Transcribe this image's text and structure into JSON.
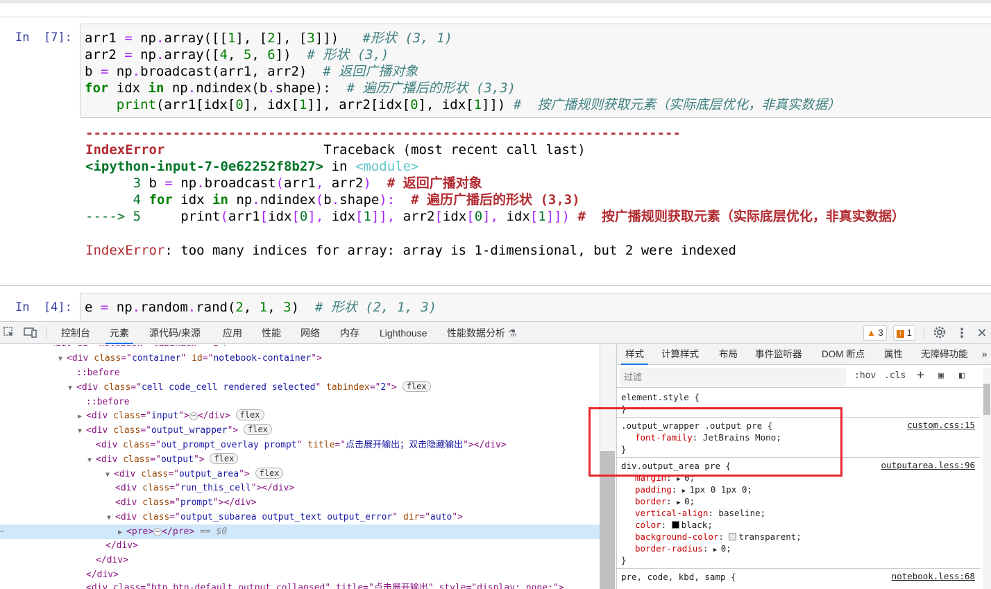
{
  "notebook": {
    "cell7": {
      "prompt": "In  [7]:",
      "lines": [
        "arr1 = np.array([[1], [2], [3]])   #形状 (3, 1)",
        "arr2 = np.array([4, 5, 6])  # 形状 (3,)",
        "b = np.broadcast(arr1, arr2)  # 返回广播对象",
        "for idx in np.ndindex(b.shape):  # 遍历广播后的形状 (3,3)",
        "    print(arr1[idx[0], idx[1]], arr2[idx[0], idx[1]]) #  按广播规则获取元素（实际底层优化，非真实数据）"
      ]
    },
    "output7": {
      "dashes": "---------------------------------------------------------------------------",
      "error_name": "IndexError",
      "traceback_label": "Traceback (most recent call last)",
      "input_ref": "<ipython-input-7-0e62252f8b27>",
      "in_word": " in ",
      "module": "<module>",
      "tb_lines": [
        "      3 b = np.broadcast(arr1, arr2)  # 返回广播对象",
        "      4 for idx in np.ndindex(b.shape):  # 遍历广播后的形状 (3,3)",
        "----> 5     print(arr1[idx[0], idx[1]], arr2[idx[0], idx[1]]) #  按广播规则获取元素（实际底层优化，非真实数据）"
      ],
      "error_message": ": too many indices for array: array is 1-dimensional, but 2 were indexed"
    },
    "cell4": {
      "prompt": "In  [4]:",
      "line": "e = np.random.rand(2, 1, 3)  # 形状 (2, 1, 3)"
    }
  },
  "devtools": {
    "tabs": [
      "控制台",
      "元素",
      "源代码/来源",
      "应用",
      "性能",
      "网络",
      "内存",
      "Lighthouse",
      "性能数据分析"
    ],
    "active_tab": "元素",
    "warning_count": "3",
    "issue_count": "1",
    "elements": [
      {
        "text": "<div id=\"notebook\" tabindex=\"-1\">"
      },
      {
        "tag": "div",
        "attrs": [
          [
            "class",
            "container"
          ],
          [
            "id",
            "notebook-container"
          ]
        ]
      },
      {
        "pseudo": "::before"
      },
      {
        "tag": "div",
        "attrs": [
          [
            "class",
            "cell code_cell rendered selected"
          ],
          [
            "tabindex",
            "2"
          ]
        ],
        "pill": "flex"
      },
      {
        "pseudo": "::before"
      },
      {
        "tag": "div",
        "attrs": [
          [
            "class",
            "input"
          ]
        ],
        "collapsed": true,
        "pill": "flex"
      },
      {
        "tag": "div",
        "attrs": [
          [
            "class",
            "output_wrapper"
          ]
        ],
        "pill": "flex"
      },
      {
        "tag": "div",
        "attrs": [
          [
            "class",
            "out_prompt_overlay prompt"
          ],
          [
            "title",
            "点击展开输出；双击隐藏输出"
          ]
        ],
        "closed": true
      },
      {
        "tag": "div",
        "attrs": [
          [
            "class",
            "output"
          ]
        ],
        "pill": "flex"
      },
      {
        "tag": "div",
        "attrs": [
          [
            "class",
            "output_area"
          ]
        ],
        "pill": "flex"
      },
      {
        "tag": "div",
        "attrs": [
          [
            "class",
            "run_this_cell"
          ]
        ],
        "closed": true
      },
      {
        "tag": "div",
        "attrs": [
          [
            "class",
            "prompt"
          ]
        ],
        "closed": true
      },
      {
        "tag": "div",
        "attrs": [
          [
            "class",
            "output_subarea output_text output_error"
          ],
          [
            "dir",
            "auto"
          ]
        ]
      },
      {
        "tag": "pre",
        "collapsed": true,
        "eq": "== $0"
      },
      {
        "close": "div"
      },
      {
        "close": "div"
      },
      {
        "close": "div"
      },
      {
        "text": "<div class=\"btn btn-default output_collapsed\" title=\"点击展开输出\" style=\"display: none;\">"
      }
    ],
    "styles": {
      "tabs": [
        "样式",
        "计算样式",
        "布局",
        "事件监听器",
        "DOM 断点",
        "属性",
        "无障碍功能"
      ],
      "active_tab": "样式",
      "filter_placeholder": "过滤",
      "hov": ":hov",
      "cls": ".cls",
      "rules": [
        {
          "selector": "element.style {",
          "props": [],
          "close": "}"
        },
        {
          "selector": ".output_wrapper .output pre {",
          "source": "custom.css:15",
          "props": [
            [
              "font-family",
              "JetBrains Mono;"
            ]
          ],
          "close": "}"
        },
        {
          "selector": "div.output_area pre {",
          "source": "outputarea.less:96",
          "props": [
            [
              "margin",
              "0;"
            ],
            [
              "padding",
              "1px 0 1px 0;"
            ],
            [
              "border",
              "0;"
            ],
            [
              "vertical-align",
              "baseline;"
            ],
            [
              "color",
              "black;"
            ],
            [
              "background-color",
              "transparent;"
            ],
            [
              "border-radius",
              "0;"
            ]
          ],
          "close": "}"
        },
        {
          "selector": "pre, code, kbd, samp {",
          "source": "notebook.less:68",
          "props": [],
          "close": ""
        }
      ]
    }
  },
  "colors": {
    "highlight_box": "#e8262b",
    "selected_row": "#cfe8fc",
    "prompt_blue": "#303f9f",
    "error_red": "#b22b31",
    "traceback_green": "#007427"
  }
}
